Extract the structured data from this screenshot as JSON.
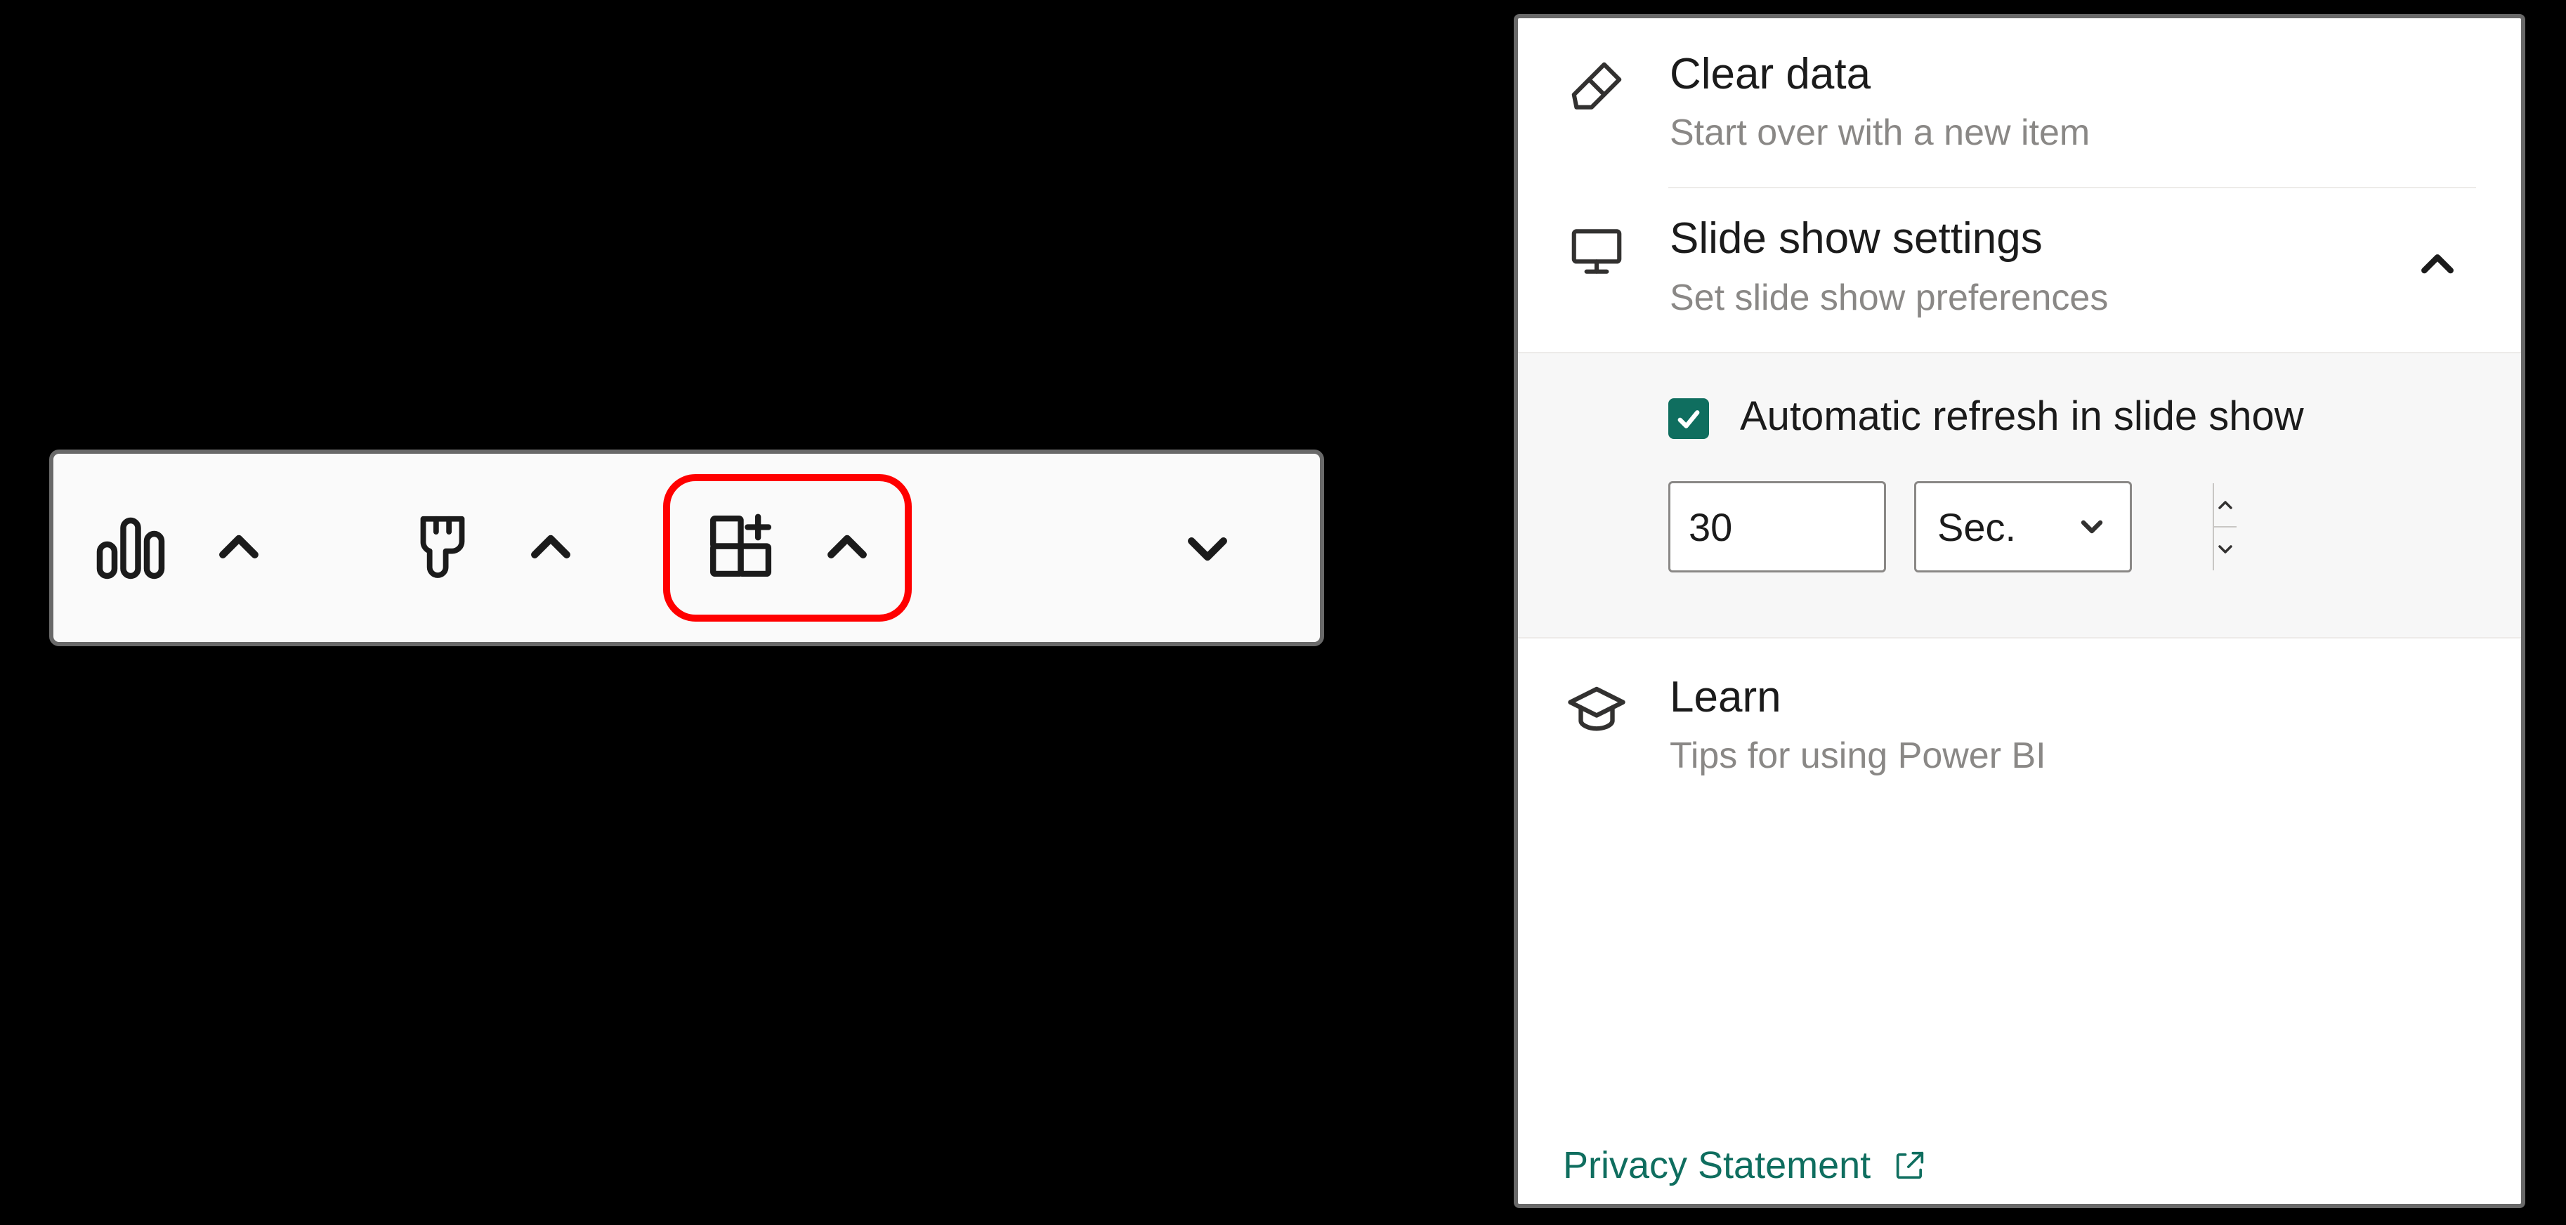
{
  "toolbar": {
    "data_icon": "bar-chart-icon",
    "format_icon": "paint-brush-icon",
    "addin_icon": "apps-add-icon",
    "collapse_icon": "chevron-down-icon"
  },
  "panel": {
    "clear": {
      "title": "Clear data",
      "subtitle": "Start over with a new item"
    },
    "slideshow": {
      "title": "Slide show settings",
      "subtitle": "Set slide show preferences",
      "expanded": true,
      "auto_refresh_label": "Automatic refresh in slide show",
      "auto_refresh_checked": true,
      "interval_value": "30",
      "unit_label": "Sec."
    },
    "learn": {
      "title": "Learn",
      "subtitle": "Tips for using Power BI"
    },
    "privacy_label": "Privacy Statement"
  }
}
